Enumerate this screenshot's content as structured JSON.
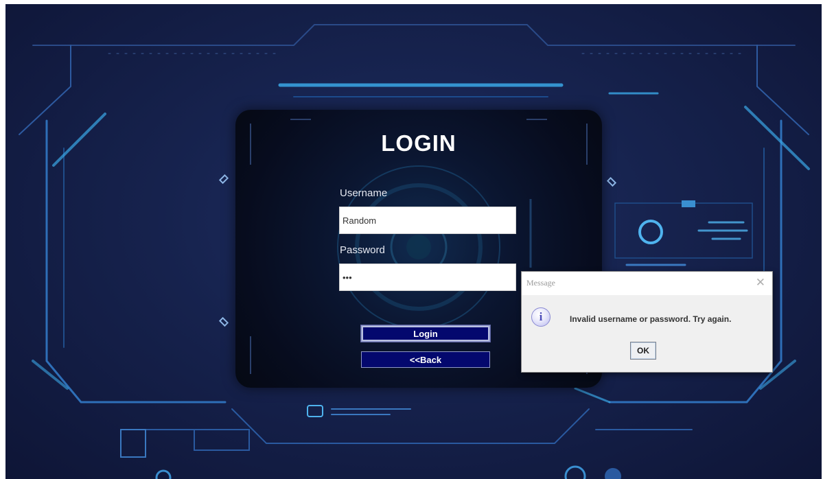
{
  "login": {
    "title": "LOGIN",
    "username_label": "Username",
    "username_value": "Random",
    "password_label": "Password",
    "password_value": "•••",
    "login_button": "Login",
    "back_button": "<<Back"
  },
  "dialog": {
    "title": "Message",
    "close_symbol": "✕",
    "icon": "info-icon",
    "icon_glyph": "i",
    "message": "Invalid username or password. Try again.",
    "ok_button": "OK"
  },
  "colors": {
    "background": "#16224d",
    "accent_cyan": "#3aa7e6",
    "button_navy": "#04086e",
    "dialog_bg": "#f0f0f0"
  }
}
